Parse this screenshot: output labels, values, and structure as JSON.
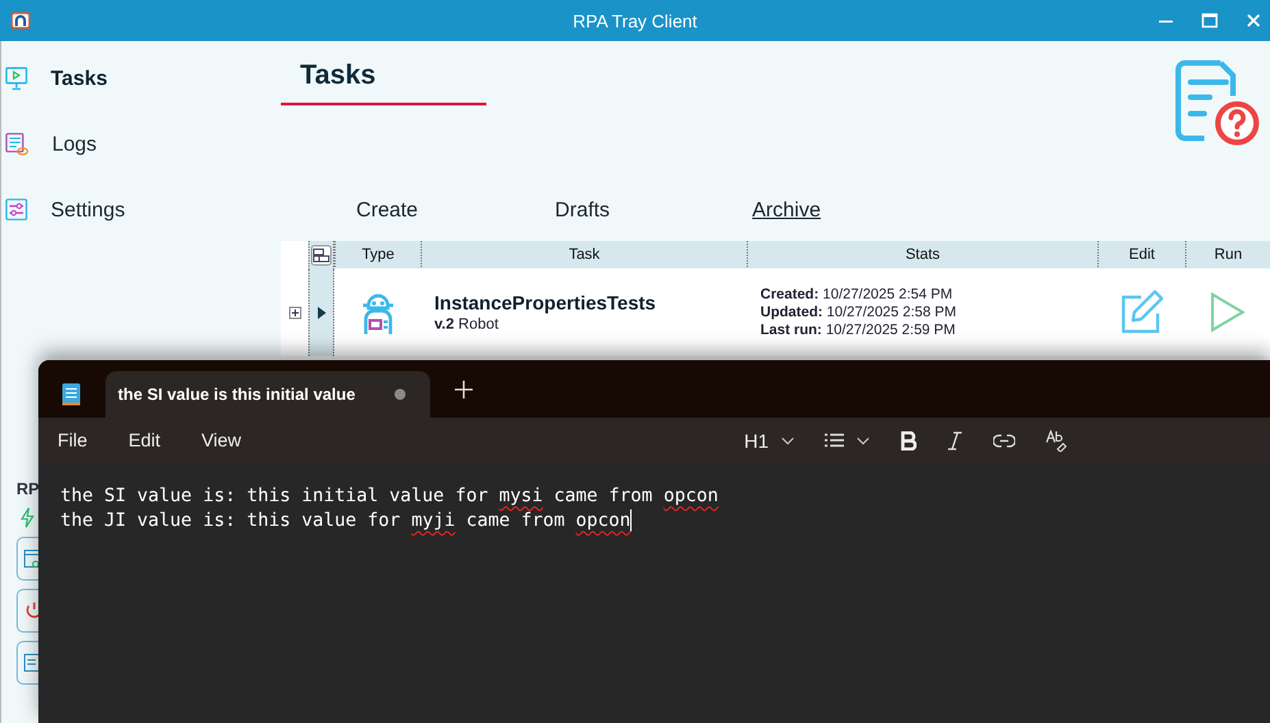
{
  "rpa_window": {
    "title": "RPA Tray Client",
    "sidebar": {
      "items": [
        {
          "label": "Tasks",
          "kind": "tasks",
          "selected": true
        },
        {
          "label": "Logs",
          "kind": "logs",
          "selected": false
        },
        {
          "label": "Settings",
          "kind": "settings",
          "selected": false
        }
      ],
      "section_label": "RP"
    },
    "page_title": "Tasks",
    "subtabs": [
      {
        "label": "Create",
        "selected": false
      },
      {
        "label": "Drafts",
        "selected": false
      },
      {
        "label": "Archive",
        "selected": true
      }
    ],
    "table": {
      "columns": [
        "Type",
        "Task",
        "Stats",
        "Edit",
        "Run"
      ],
      "rows": [
        {
          "name": "InstancePropertiesTests",
          "version": "v.2",
          "type": "Robot",
          "expanded": false,
          "stats": [
            {
              "label": "Created:",
              "value": "10/27/2025 2:54 PM"
            },
            {
              "label": "Updated:",
              "value": "10/27/2025 2:58 PM"
            },
            {
              "label": "Last run:",
              "value": "10/27/2025 2:59 PM"
            }
          ]
        }
      ]
    }
  },
  "notepad": {
    "tab": {
      "title": "the SI value is this initial value",
      "modified": true
    },
    "menu": [
      "File",
      "Edit",
      "View"
    ],
    "heading_level": "H1",
    "lines": [
      [
        {
          "text": "the SI value is: this initial value for ",
          "misspelled": false
        },
        {
          "text": "mysi",
          "misspelled": true
        },
        {
          "text": " came from ",
          "misspelled": false
        },
        {
          "text": "opcon",
          "misspelled": true
        }
      ],
      [
        {
          "text": "the JI value is: this value for ",
          "misspelled": false
        },
        {
          "text": "myji",
          "misspelled": true
        },
        {
          "text": " came from ",
          "misspelled": false
        },
        {
          "text": "opcon",
          "misspelled": true
        }
      ]
    ]
  }
}
